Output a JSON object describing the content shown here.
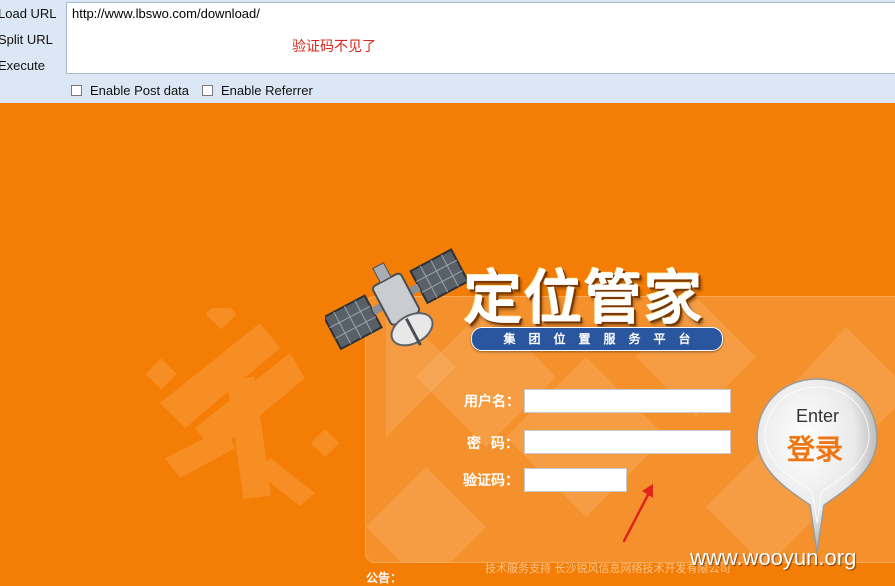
{
  "hackbar": {
    "load_url_label": "Load URL",
    "split_url_label": "Split URL",
    "execute_label": "Execute",
    "url_value": "http://www.lbswo.com/download/",
    "annotation": "验证码不见了",
    "enable_post_label": "Enable Post data",
    "enable_referrer_label": "Enable Referrer"
  },
  "login_page": {
    "brand": "定位管家",
    "slogan": "集团位置服务平台",
    "username_label": "用户名：",
    "password_label": "密  码：",
    "captcha_label": "验证码：",
    "enter_label_en": "Enter",
    "enter_label_zh": "登录",
    "notice_label": "公告：",
    "tech_support": "技术服务支持 长沙锐风信息网络技术开发有限公司",
    "watermark": "www.wooyun.org"
  },
  "colors": {
    "page_background": "#f47d05",
    "hackbar_background": "#dce7f5",
    "annotation_red": "#d9271d",
    "slogan_blue": "#2a56a0",
    "enter_orange": "#ef7612"
  }
}
